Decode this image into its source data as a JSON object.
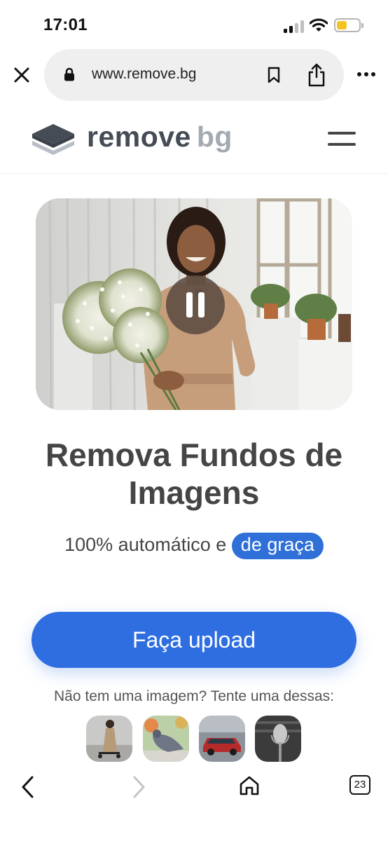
{
  "status": {
    "time": "17:01",
    "battery_percent": 45,
    "signal_bars": 2
  },
  "browser": {
    "url": "www.remove.bg",
    "tab_count": "23"
  },
  "brand": {
    "name_part1": "remove",
    "name_part2": "bg",
    "accent": "#2e6ee1"
  },
  "hero": {
    "title": "Remova Fundos de Imagens",
    "subtitle_prefix": "100% automático e",
    "subtitle_highlight": "de graça"
  },
  "upload": {
    "label": "Faça upload"
  },
  "samples": {
    "prompt": "Não tem uma imagem? Tente uma dessas:",
    "items": [
      "person-sample",
      "pigeon-sample",
      "car-sample",
      "microphone-sample"
    ]
  },
  "icons": [
    "close-icon",
    "lock-icon",
    "bookmark-icon",
    "share-icon",
    "more-icon",
    "menu-icon",
    "pause-icon",
    "back-icon",
    "forward-icon",
    "home-icon",
    "tabs-icon"
  ]
}
